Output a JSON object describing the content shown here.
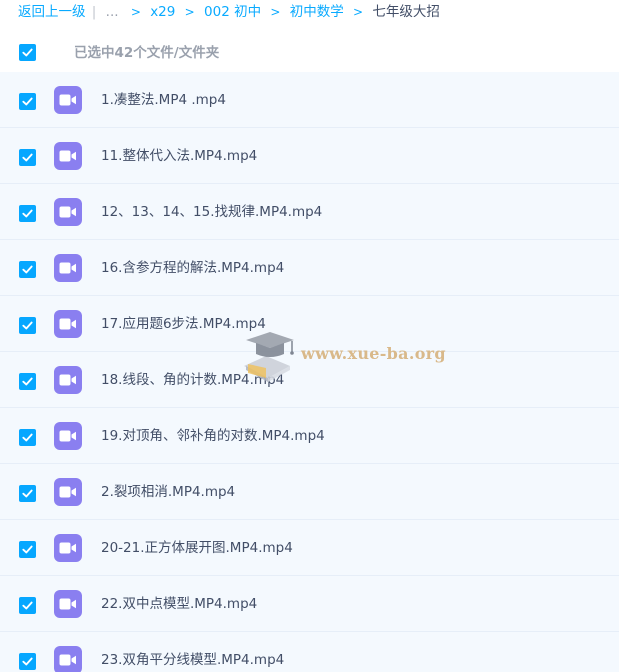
{
  "breadcrumb": {
    "back": "返回上一级",
    "separator": "|",
    "ellipsis": "...",
    "arrow": ">",
    "path": [
      "x29",
      "002 初中",
      "初中数学"
    ],
    "current": "七年级大招"
  },
  "selection": {
    "label": "已选中42个文件/文件夹",
    "checked": true
  },
  "files": [
    {
      "name": "1.凑整法.MP4 .mp4",
      "checked": true
    },
    {
      "name": "11.整体代入法.MP4.mp4",
      "checked": true
    },
    {
      "name": "12、13、14、15.找规律.MP4.mp4",
      "checked": true
    },
    {
      "name": "16.含参方程的解法.MP4.mp4",
      "checked": true
    },
    {
      "name": "17.应用题6步法.MP4.mp4",
      "checked": true
    },
    {
      "name": "18.线段、角的计数.MP4.mp4",
      "checked": true
    },
    {
      "name": "19.对顶角、邻补角的对数.MP4.mp4",
      "checked": true
    },
    {
      "name": "2.裂项相消.MP4.mp4",
      "checked": true
    },
    {
      "name": "20-21.正方体展开图.MP4.mp4",
      "checked": true
    },
    {
      "name": "22.双中点模型.MP4.mp4",
      "checked": true
    },
    {
      "name": "23.双角平分线模型.MP4.mp4",
      "checked": true
    }
  ],
  "watermark": {
    "text": "www.xue-ba.org"
  },
  "colors": {
    "accent": "#06a7ff",
    "link": "#09aaff",
    "video_icon": "#8a7ff0",
    "row_bg": "#f4f9fe"
  },
  "icons": {
    "checkbox": "checkbox-checked-icon",
    "file": "video-file-icon",
    "watermark": "graduation-cap-icon"
  }
}
